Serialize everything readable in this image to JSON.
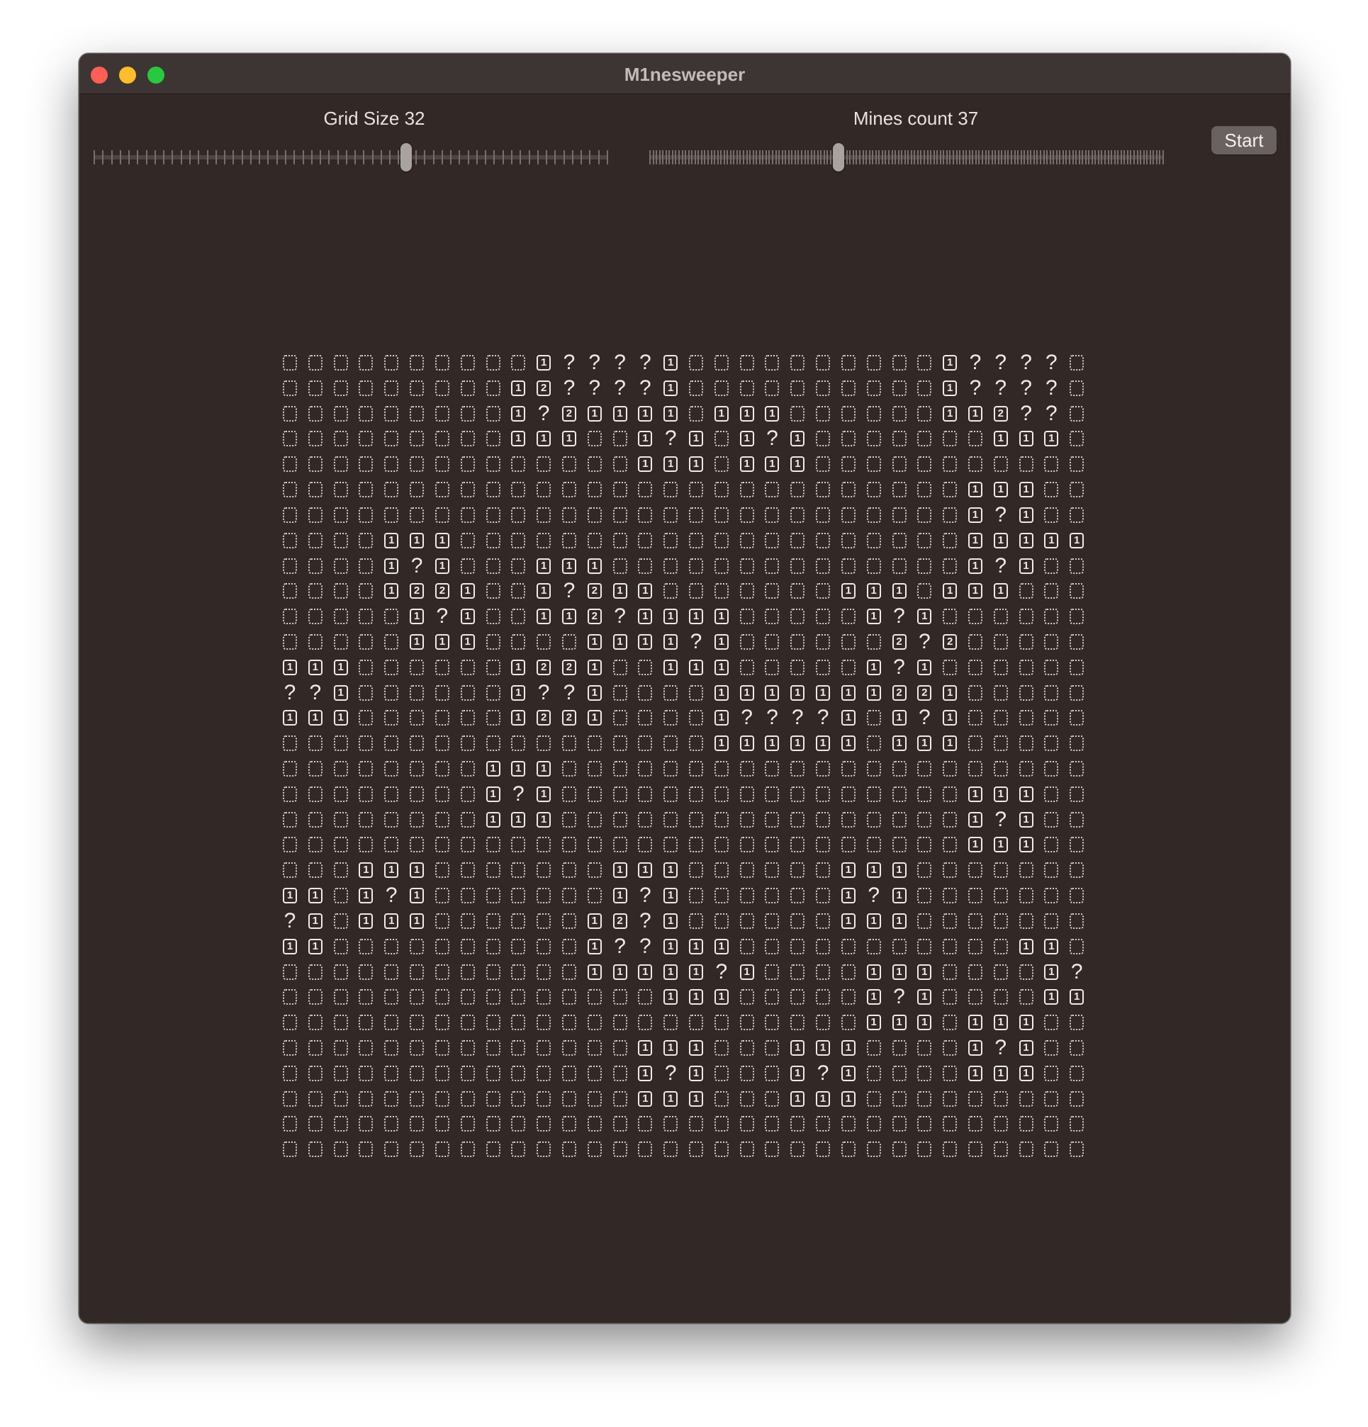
{
  "window": {
    "title": "M1nesweeper"
  },
  "controls": {
    "grid_size_label": "Grid Size 32",
    "grid_size_value": 32,
    "grid_size_fraction": 0.61,
    "mines_label": "Mines count 37",
    "mines_value": 37,
    "mines_fraction": 0.365,
    "start_label": "Start"
  },
  "board": {
    "size": 32,
    "legend": {
      ".": "hidden",
      "1": "one",
      "2": "two",
      "?": "unknown"
    },
    "rows": [
      "..........1????1..........1????",
      ".........12????1..........1????",
      ".........1?21111.111......112??",
      ".........111..1?1.1?1.......111",
      "..............111.111..........",
      "...........................111.",
      "...........................1?1.",
      "....111....................111111.",
      "....1?1...111..............1?1.",
      "....1221..1?211.......111.111.",
      ".....1?1..112?1111.....1?1.....",
      ".....111....1111?1......2?2....",
      "111......1221..111.....1?1.....",
      "??1......1??1....111111122 1....",
      "111......1221....1????1.1?1....",
      ".................111111.111....",
      "........111....................",
      "........1?1................111..",
      "........111................1?1..",
      "...........................111..",
      "...111.......111......111.......",
      "11.1?1.......1?1......1?1.......",
      "?1.111......12?1......111.......",
      "11..........1??111...........11",
      "............11111?1....111....1?",
      "...............111.....1?1....11",
      ".......................111.111...",
      "..............111...111....1?1...",
      "..............1?1...1?1....111...",
      "..............111...111.........",
      "................................",
      "................................"
    ]
  }
}
